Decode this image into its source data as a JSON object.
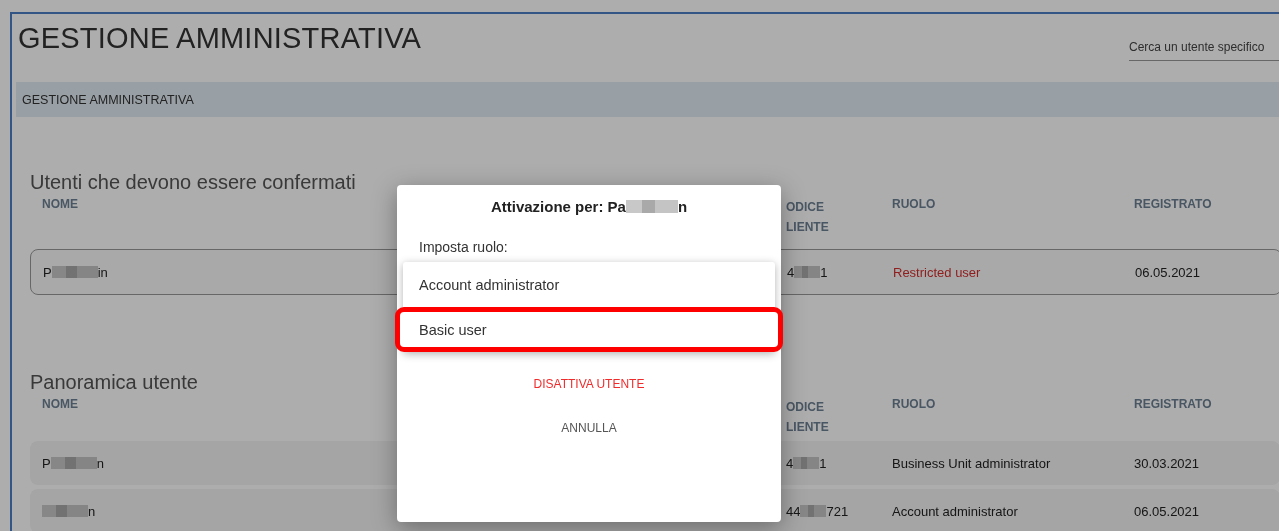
{
  "page_title": "GESTIONE AMMINISTRATIVA",
  "search": {
    "placeholder": "Cerca un utente specifico"
  },
  "breadcrumb": "GESTIONE AMMINISTRATIVA",
  "sections": [
    {
      "title": "Utenti che devono essere confermati",
      "outlined_rows": true,
      "columns": [
        "NOME",
        "ODICE LIENTE",
        "RUOLO",
        "REGISTRATO"
      ],
      "rows": [
        {
          "name_start": "P",
          "name_end": "in",
          "code_parts": [
            "4",
            "1"
          ],
          "role": "Restricted user",
          "restricted": true,
          "registered": "06.05.2021"
        }
      ]
    },
    {
      "title": "Panoramica utente",
      "outlined_rows": false,
      "columns": [
        "NOME",
        "ODICE LIENTE",
        "RUOLO",
        "REGISTRATO"
      ],
      "rows": [
        {
          "name_start": "P",
          "name_end": "n",
          "code_parts": [
            "4",
            "1"
          ],
          "role": "Business Unit administrator",
          "restricted": false,
          "registered": "30.03.2021"
        },
        {
          "name_end": "n",
          "code_parts": [
            "44",
            "721"
          ],
          "role": "Account administrator",
          "restricted": false,
          "registered": "06.05.2021"
        }
      ]
    }
  ],
  "dialog": {
    "title_parts": [
      "Attivazione per: Pa",
      "n"
    ],
    "role_label": "Imposta ruolo:",
    "options": [
      {
        "label": "Account administrator",
        "highlighted": false
      },
      {
        "label": "Basic user",
        "highlighted": true
      }
    ],
    "deactivate": "DISATTIVA UTENTE",
    "cancel": "ANNULLA"
  }
}
